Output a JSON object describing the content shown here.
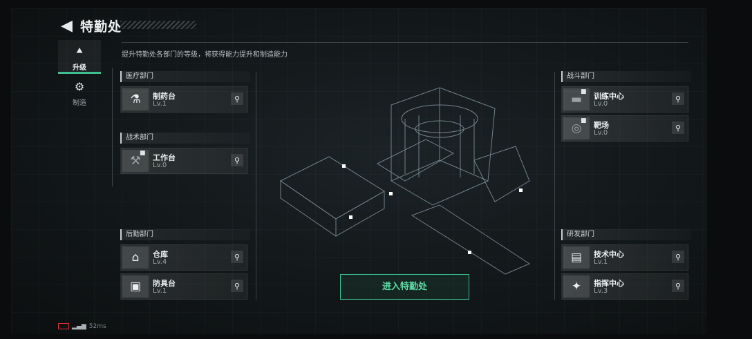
{
  "header": {
    "title": "特勤处",
    "subtitle": "提升特勤处各部门的等级，将获得能力提升和制造能力"
  },
  "nav": [
    {
      "label": "升级",
      "active": true
    },
    {
      "label": "制造",
      "active": false
    }
  ],
  "departments": {
    "medical": {
      "label": "医疗部门",
      "items": [
        {
          "name": "制药台",
          "level": "Lv.1"
        }
      ]
    },
    "tactical": {
      "label": "战术部门",
      "items": [
        {
          "name": "工作台",
          "level": "Lv.0",
          "locked": true
        }
      ]
    },
    "logistics": {
      "label": "后勤部门",
      "items": [
        {
          "name": "仓库",
          "level": "Lv.4"
        },
        {
          "name": "防具台",
          "level": "Lv.1"
        }
      ]
    },
    "combat": {
      "label": "战斗部门",
      "items": [
        {
          "name": "训练中心",
          "level": "Lv.0",
          "locked": true
        },
        {
          "name": "靶场",
          "level": "Lv.0",
          "locked": true
        }
      ]
    },
    "rnd": {
      "label": "研发部门",
      "items": [
        {
          "name": "技术中心",
          "level": "Lv.1"
        },
        {
          "name": "指挥中心",
          "level": "Lv.3"
        }
      ]
    }
  },
  "enter_button": "进入特勤处",
  "status": {
    "ping": "52ms"
  },
  "colors": {
    "accent": "#3fbf8f",
    "accent_text": "#5ee0a8",
    "lock_warning": "#dd3333"
  }
}
